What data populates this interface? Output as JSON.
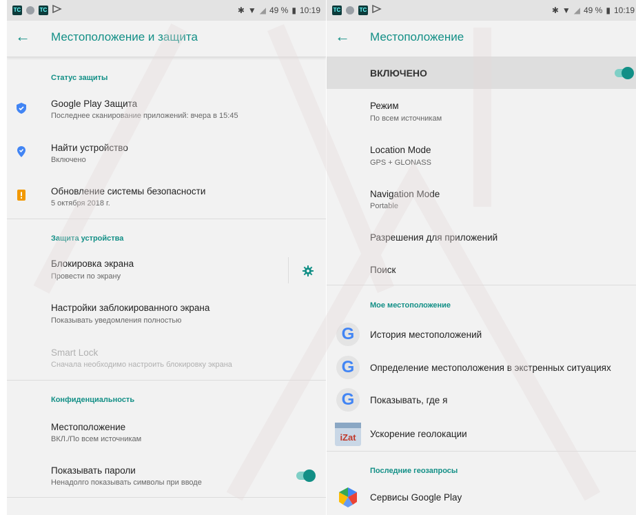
{
  "left": {
    "status_bar": {
      "time": "10:19",
      "battery": "49 %",
      "icons": [
        "tc-icon",
        "circle-icon",
        "tc-icon",
        "cast-icon"
      ]
    },
    "app_bar": {
      "title": "Местоположение и защита"
    },
    "sections": {
      "security_status": "Статус защиты",
      "device_protection": "Защита устройства",
      "privacy": "Конфиденциальность"
    },
    "items": {
      "play_protect": {
        "title": "Google Play Защита",
        "subtitle": "Последнее сканирование приложений: вчера в 15:45"
      },
      "find_device": {
        "title": "Найти устройство",
        "subtitle": "Включено"
      },
      "security_update": {
        "title": "Обновление системы безопасности",
        "subtitle": "5 октября 2018 г."
      },
      "screen_lock": {
        "title": "Блокировка экрана",
        "subtitle": "Провести по экрану"
      },
      "lock_screen_settings": {
        "title": "Настройки заблокированного экрана",
        "subtitle": "Показывать уведомления полностью"
      },
      "smart_lock": {
        "title": "Smart Lock",
        "subtitle": "Сначала необходимо настроить блокировку экрана"
      },
      "location": {
        "title": "Местоположение",
        "subtitle": "ВКЛ./По всем источникам"
      },
      "show_passwords": {
        "title": "Показывать пароли",
        "subtitle": "Ненадолго показывать символы при вводе",
        "enabled": true
      }
    }
  },
  "right": {
    "status_bar": {
      "time": "10:19",
      "battery": "49 %",
      "icons": [
        "tc-icon",
        "circle-icon",
        "tc-icon",
        "cast-icon"
      ]
    },
    "app_bar": {
      "title": "Местоположение"
    },
    "master_switch": {
      "label": "ВКЛЮЧЕНО",
      "enabled": true
    },
    "items": {
      "mode": {
        "title": "Режим",
        "subtitle": "По всем источникам"
      },
      "location_mode": {
        "title": "Location Mode",
        "subtitle": "GPS + GLONASS"
      },
      "navigation_mode": {
        "title": "Navigation Mode",
        "subtitle": "Portable"
      },
      "app_permissions": {
        "title": "Разрешения для приложений"
      },
      "search": {
        "title": "Поиск"
      }
    },
    "sections": {
      "my_location": "Мое местоположение",
      "recent_requests": "Последние геозапросы"
    },
    "my_location_items": [
      {
        "label": "История местоположений",
        "icon": "google-icon"
      },
      {
        "label": "Определение местоположения в экстренных ситуациях",
        "icon": "google-icon"
      },
      {
        "label": "Показывать, где я",
        "icon": "google-icon"
      },
      {
        "label": "Ускорение геолокации",
        "icon": "qualcomm-izat-icon"
      }
    ],
    "recent_items": [
      {
        "label": "Сервисы Google Play",
        "icon": "google-play-services-icon"
      }
    ]
  }
}
